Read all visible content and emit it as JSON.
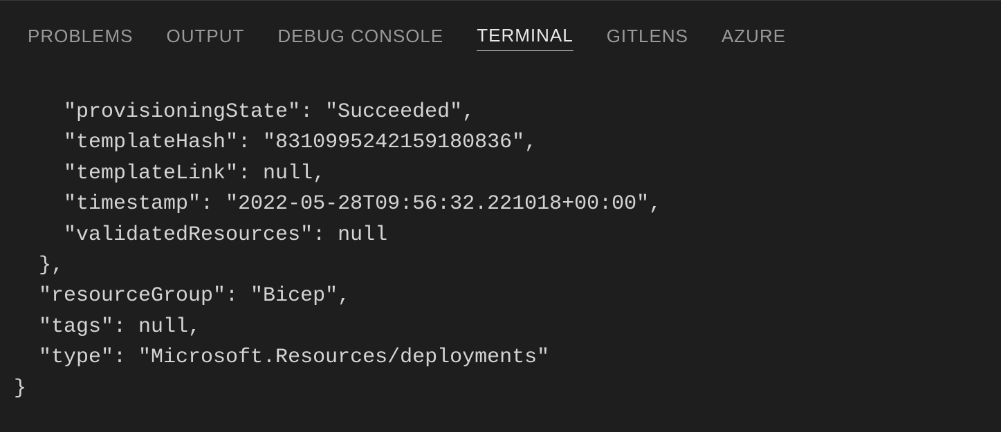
{
  "tabs": {
    "problems": "PROBLEMS",
    "output": "OUTPUT",
    "debugConsole": "DEBUG CONSOLE",
    "terminal": "TERMINAL",
    "gitlens": "GITLENS",
    "azure": "AZURE"
  },
  "terminal": {
    "line1": "    \"provisioningState\": \"Succeeded\",",
    "line2": "    \"templateHash\": \"8310995242159180836\",",
    "line3": "    \"templateLink\": null,",
    "line4": "    \"timestamp\": \"2022-05-28T09:56:32.221018+00:00\",",
    "line5": "    \"validatedResources\": null",
    "line6": "  },",
    "line7": "  \"resourceGroup\": \"Bicep\",",
    "line8": "  \"tags\": null,",
    "line9": "  \"type\": \"Microsoft.Resources/deployments\"",
    "line10": "}"
  }
}
